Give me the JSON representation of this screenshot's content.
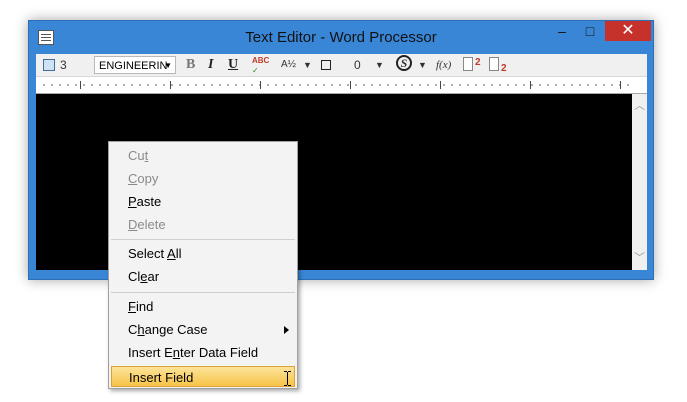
{
  "window": {
    "title": "Text Editor - Word Processor",
    "minimize_glyph": "–",
    "maximize_glyph": "□",
    "close_glyph": "✕"
  },
  "toolbar": {
    "style_value": "3",
    "font_value": "ENGINEERIN",
    "bold": "B",
    "italic": "I",
    "underline": "U",
    "spellcheck": "ABC",
    "font_size_value": "0",
    "special_char": "S",
    "function": "f(x)",
    "superscript_num": "2",
    "subscript_num": "2"
  },
  "context_menu": {
    "items": [
      {
        "label": "Cut",
        "pre": "Cu",
        "ul": "t",
        "post": "",
        "enabled": false
      },
      {
        "label": "Copy",
        "pre": "",
        "ul": "C",
        "post": "opy",
        "enabled": false
      },
      {
        "label": "Paste",
        "pre": "",
        "ul": "P",
        "post": "aste",
        "enabled": true
      },
      {
        "label": "Delete",
        "pre": "",
        "ul": "D",
        "post": "elete",
        "enabled": false
      },
      {
        "label": "Select All",
        "pre": "Select ",
        "ul": "A",
        "post": "ll",
        "enabled": true
      },
      {
        "label": "Clear",
        "pre": "Cl",
        "ul": "e",
        "post": "ar",
        "enabled": true
      },
      {
        "label": "Find",
        "pre": "",
        "ul": "F",
        "post": "ind",
        "enabled": true
      },
      {
        "label": "Change Case",
        "pre": "C",
        "ul": "h",
        "post": "ange Case",
        "enabled": true
      },
      {
        "label": "Insert Enter Data Field",
        "pre": "Insert E",
        "ul": "n",
        "post": "ter Data Field",
        "enabled": true
      },
      {
        "label": "Insert Field",
        "pre": "Insert Field",
        "ul": "",
        "post": "",
        "enabled": true,
        "highlighted": true
      }
    ]
  },
  "colors": {
    "title_bar": "#3a86d6",
    "close_button": "#c7312b",
    "editor_background": "#000000",
    "menu_highlight": "#f6c449"
  }
}
